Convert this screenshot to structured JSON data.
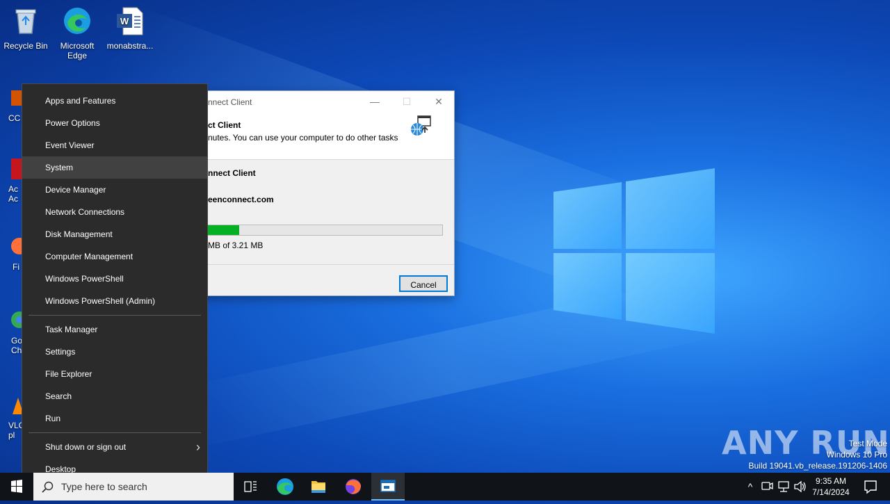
{
  "desktop": {
    "icons": [
      {
        "label": "Recycle Bin"
      },
      {
        "label": "Microsoft Edge"
      },
      {
        "label": "monabstra..."
      }
    ],
    "partial_icons": [
      {
        "label": "CC"
      },
      {
        "label": "Ac Ac"
      },
      {
        "label": "Fi"
      },
      {
        "label": "Go Ch"
      },
      {
        "label": "VLC pl"
      }
    ]
  },
  "dialog": {
    "title": "nnect Client",
    "header_title": "ct Client",
    "header_text": "nutes. You can use your computer to do other tasks",
    "body_line1": "nnect Client",
    "body_line2": "eenconnect.com",
    "progress_fraction": 0.15,
    "progress_text": "MB of 3.21 MB",
    "cancel_label": "Cancel",
    "minimize_glyph": "—",
    "maximize_glyph": "☐",
    "close_glyph": "✕"
  },
  "menu": {
    "items_group1": [
      "Apps and Features",
      "Power Options",
      "Event Viewer",
      "System",
      "Device Manager",
      "Network Connections",
      "Disk Management",
      "Computer Management",
      "Windows PowerShell",
      "Windows PowerShell (Admin)"
    ],
    "items_group2": [
      "Task Manager",
      "Settings",
      "File Explorer",
      "Search",
      "Run"
    ],
    "shutdown_label": "Shut down or sign out",
    "shutdown_arrow": "›",
    "desktop_label": "Desktop",
    "hovered": "System"
  },
  "taskbar": {
    "search_placeholder": "Type here to search",
    "time": "9:35 AM",
    "date": "7/14/2024",
    "tray_up_glyph": "^"
  },
  "watermark": {
    "line1": "Test Mode",
    "line2": "Windows 10 Pro",
    "line3": "Build 19041.vb_release.191206-1406",
    "brand": "ANY RUN"
  }
}
